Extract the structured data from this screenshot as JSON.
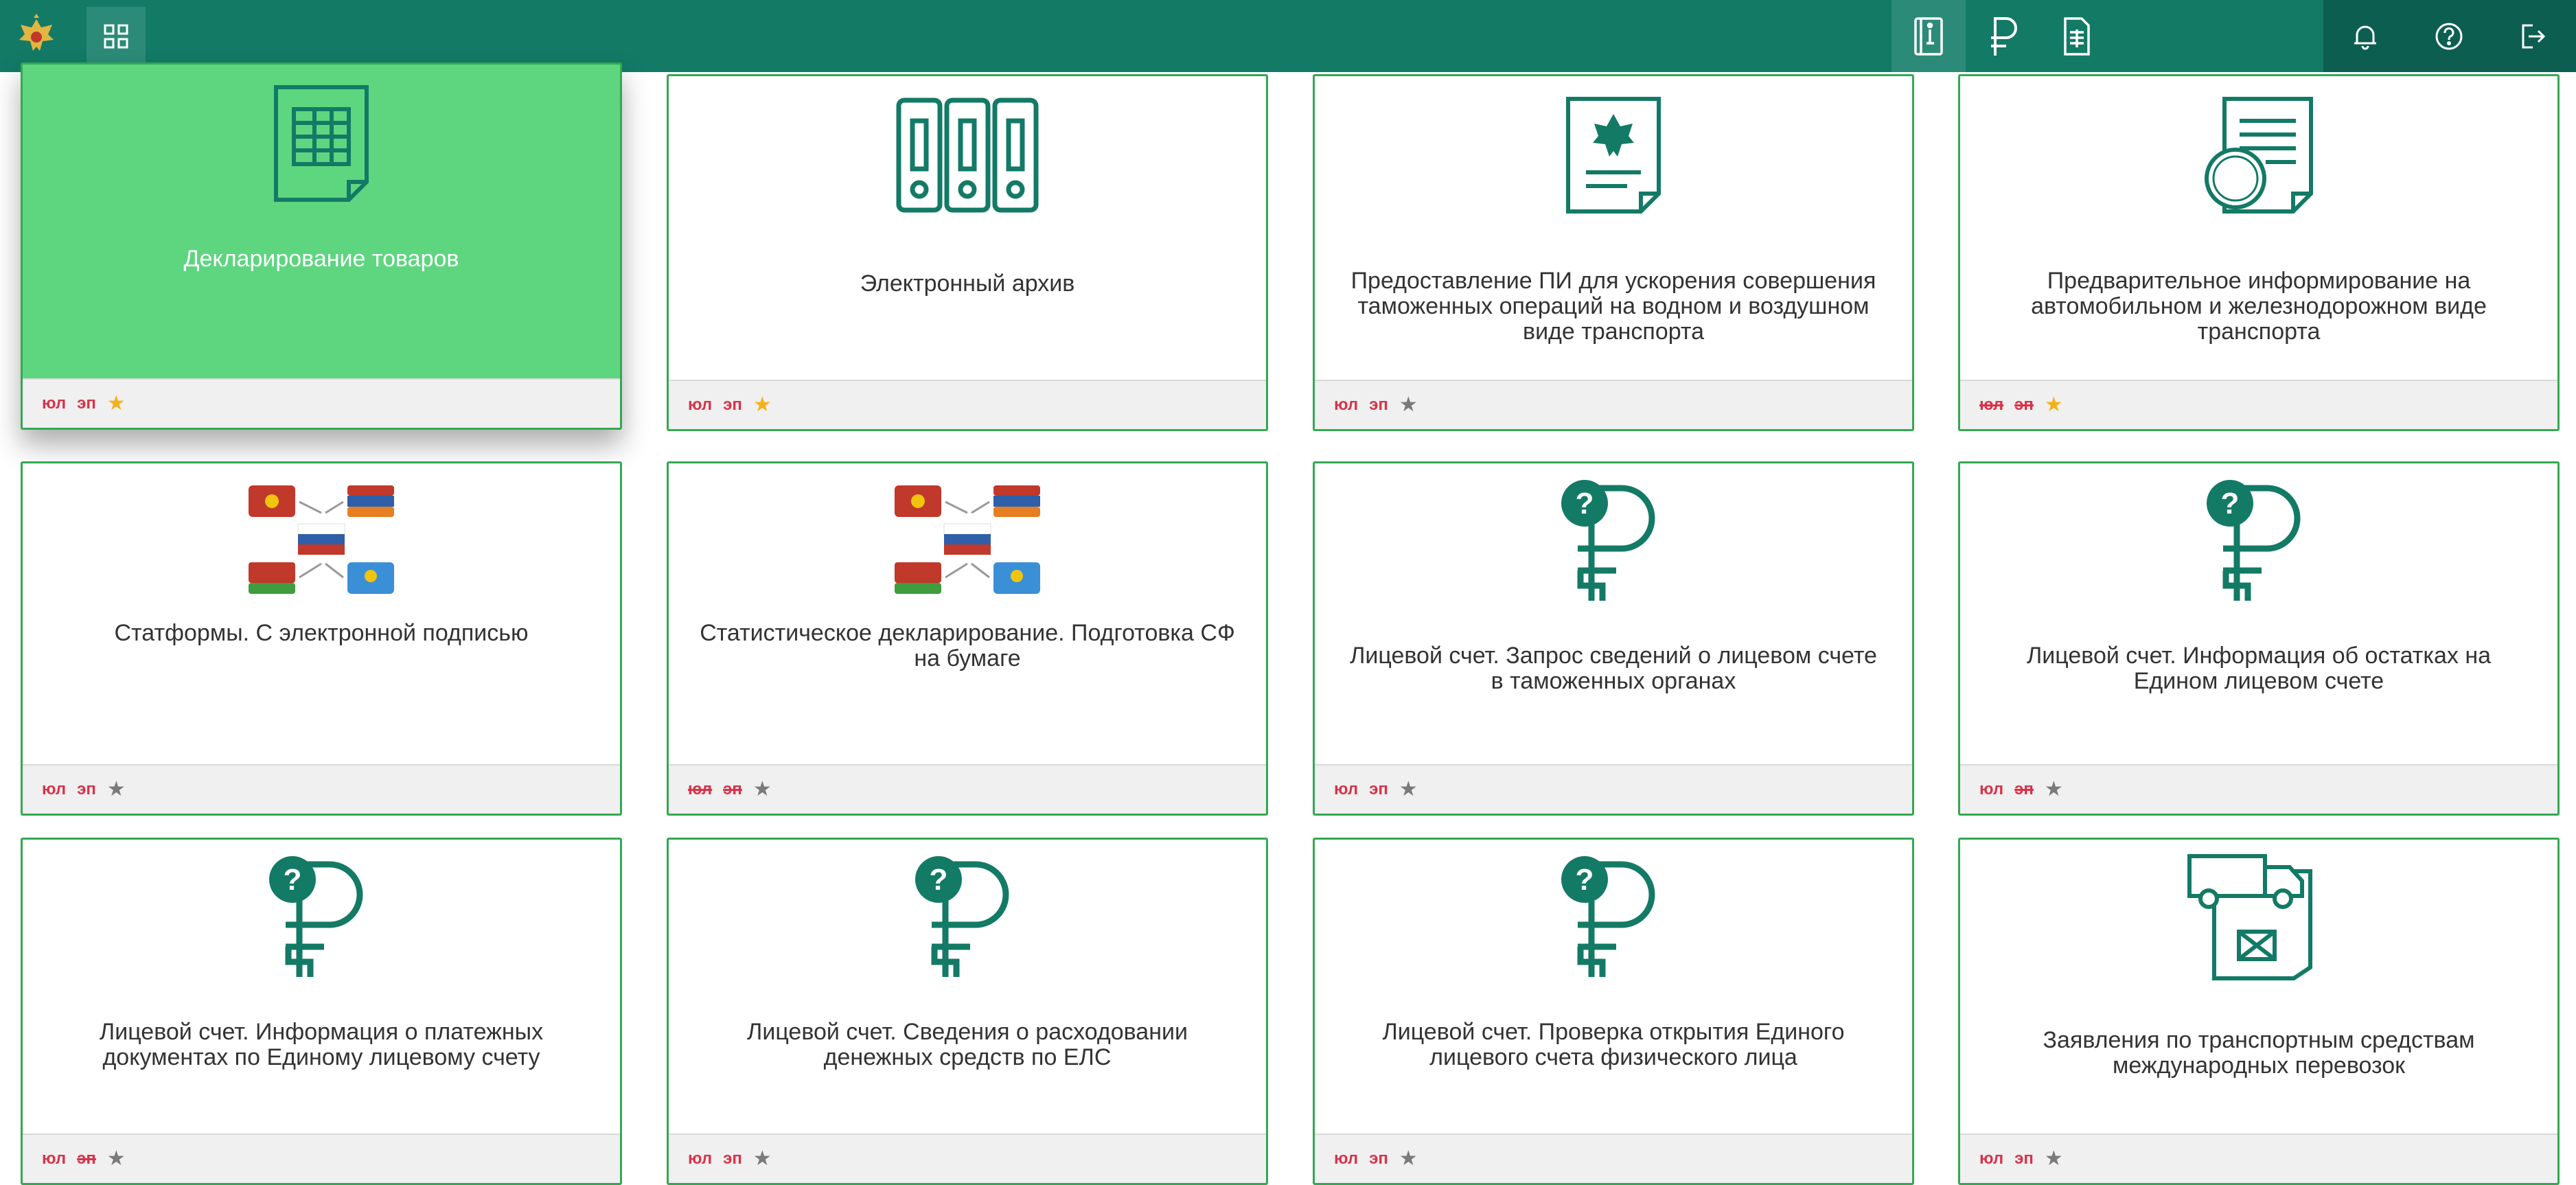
{
  "header": {
    "icons": {
      "logo": "eagle-emblem",
      "apps": "grid-icon",
      "book": "book-icon",
      "currency": "ruble-icon",
      "document": "document-icon",
      "notifications": "bell-icon",
      "help": "question-circle-icon",
      "logout": "logout-icon"
    }
  },
  "colors": {
    "topbar": "#137a66",
    "tile_border": "#34a853",
    "active_tile": "#5dd67f",
    "tag": "#d8334a",
    "star_on": "#f3b21b",
    "star_off": "#7a7a7a"
  },
  "tiles": [
    {
      "title": "Декларирование товаров",
      "icon": "spreadsheet-icon",
      "tag1": "юл",
      "tag2": "эп",
      "tag1_struck": false,
      "tag2_struck": false,
      "starred": true,
      "active": true
    },
    {
      "title": "Электронный архив",
      "icon": "archive-binders-icon",
      "tag1": "юл",
      "tag2": "эп",
      "tag1_struck": false,
      "tag2_struck": false,
      "starred": true,
      "active": false
    },
    {
      "title": "Предоставление ПИ для ускорения совершения таможенных операций на водном и воздушном виде транспорта",
      "icon": "emblem-document-icon",
      "tag1": "юл",
      "tag2": "эп",
      "tag1_struck": false,
      "tag2_struck": false,
      "starred": false,
      "active": false
    },
    {
      "title": "Предварительное информирование на автомобильном и железнодорожном виде транспорта",
      "icon": "custom-stamp-document-icon",
      "tag1": "юл",
      "tag2": "эп",
      "tag1_struck": true,
      "tag2_struck": true,
      "starred": true,
      "active": false
    },
    {
      "title": "Статформы. С электронной подписью",
      "icon": "flags-exchange-icon",
      "tag1": "юл",
      "tag2": "эп",
      "tag1_struck": false,
      "tag2_struck": false,
      "starred": false,
      "active": false
    },
    {
      "title": "Статистическое декларирование. Подготовка СФ на бумаге",
      "icon": "flags-exchange-icon",
      "tag1": "юл",
      "tag2": "эп",
      "tag1_struck": true,
      "tag2_struck": true,
      "starred": false,
      "active": false
    },
    {
      "title": "Лицевой счет. Запрос сведений о лицевом счете в таможенных органах",
      "icon": "ruble-question-icon",
      "tag1": "юл",
      "tag2": "эп",
      "tag1_struck": false,
      "tag2_struck": false,
      "starred": false,
      "active": false
    },
    {
      "title": "Лицевой счет. Информация об остатках на Едином лицевом счете",
      "icon": "ruble-question-icon",
      "tag1": "юл",
      "tag2": "эп",
      "tag1_struck": false,
      "tag2_struck": true,
      "starred": false,
      "active": false
    },
    {
      "title": "Лицевой счет. Информация о платежных документах по Единому лицевому счету",
      "icon": "ruble-question-icon",
      "tag1": "юл",
      "tag2": "эп",
      "tag1_struck": false,
      "tag2_struck": true,
      "starred": false,
      "active": false
    },
    {
      "title": "Лицевой счет. Сведения о расходовании денежных средств по ЕЛС",
      "icon": "ruble-question-icon",
      "tag1": "юл",
      "tag2": "эп",
      "tag1_struck": false,
      "tag2_struck": false,
      "starred": false,
      "active": false
    },
    {
      "title": "Лицевой счет. Проверка открытия Единого лицевого счета физического лица",
      "icon": "ruble-question-icon",
      "tag1": "юл",
      "tag2": "эп",
      "tag1_struck": false,
      "tag2_struck": false,
      "starred": false,
      "active": false
    },
    {
      "title": "Заявления по транспортным средствам международных перевозок",
      "icon": "truck-document-icon",
      "tag1": "юл",
      "tag2": "эп",
      "tag1_struck": false,
      "tag2_struck": false,
      "starred": false,
      "active": false
    }
  ]
}
